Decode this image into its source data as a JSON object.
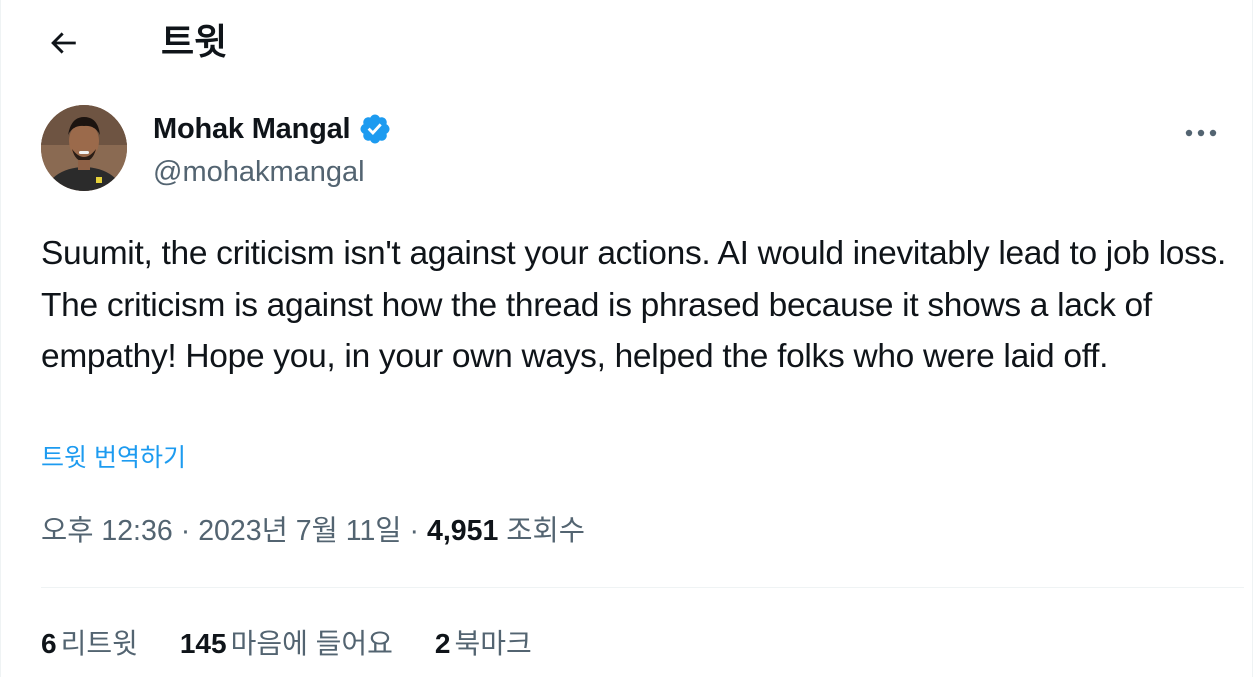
{
  "header": {
    "title": "트윗",
    "back_icon": "arrow-left-icon"
  },
  "author": {
    "name": "Mohak Mangal",
    "handle": "@mohakmangal",
    "verified": true,
    "verified_color": "#1d9bf0",
    "avatar_icon": "profile-photo"
  },
  "tweet": {
    "text": "Suumit, the criticism isn't against your actions. AI would inevitably lead to job loss. The criticism is against how the thread is phrased because it shows a lack of empathy! Hope you, in your own ways, helped the folks who were laid off.",
    "translate_label": "트윗 번역하기"
  },
  "meta": {
    "time": "오후 12:36",
    "separator": "·",
    "date": "2023년 7월 11일",
    "views_count": "4,951",
    "views_label": "조회수"
  },
  "stats": {
    "retweets_count": "6",
    "retweets_label": "리트윗",
    "likes_count": "145",
    "likes_label": "마음에 들어요",
    "bookmarks_count": "2",
    "bookmarks_label": "북마크"
  },
  "colors": {
    "accent": "#1d9bf0",
    "secondary_text": "#536471",
    "primary_text": "#0f1419",
    "divider": "#eff3f4"
  }
}
